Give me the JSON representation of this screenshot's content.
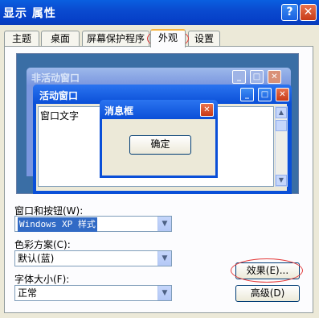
{
  "window": {
    "title": "显示 属性",
    "help_label": "?",
    "close_label": "✕"
  },
  "tabs": [
    {
      "label": "主题"
    },
    {
      "label": "桌面"
    },
    {
      "label": "屏幕保护程序"
    },
    {
      "label": "外观",
      "active": true
    },
    {
      "label": "设置"
    }
  ],
  "preview": {
    "inactive_title": "非活动窗口",
    "active_title": "活动窗口",
    "window_text": "窗口文字",
    "message_title": "消息框",
    "ok_label": "确定"
  },
  "form": {
    "windows_buttons_label": "窗口和按钮(W):",
    "windows_buttons_value": "Windows XP 样式",
    "color_scheme_label": "色彩方案(C):",
    "color_scheme_value": "默认(蓝)",
    "font_size_label": "字体大小(F):",
    "font_size_value": "正常",
    "effects_label": "效果(E)...",
    "advanced_label": "高级(D)"
  },
  "colors": {
    "accent": "#0a4fd8",
    "annotation": "#e43a3a",
    "selection": "#316ac5"
  }
}
